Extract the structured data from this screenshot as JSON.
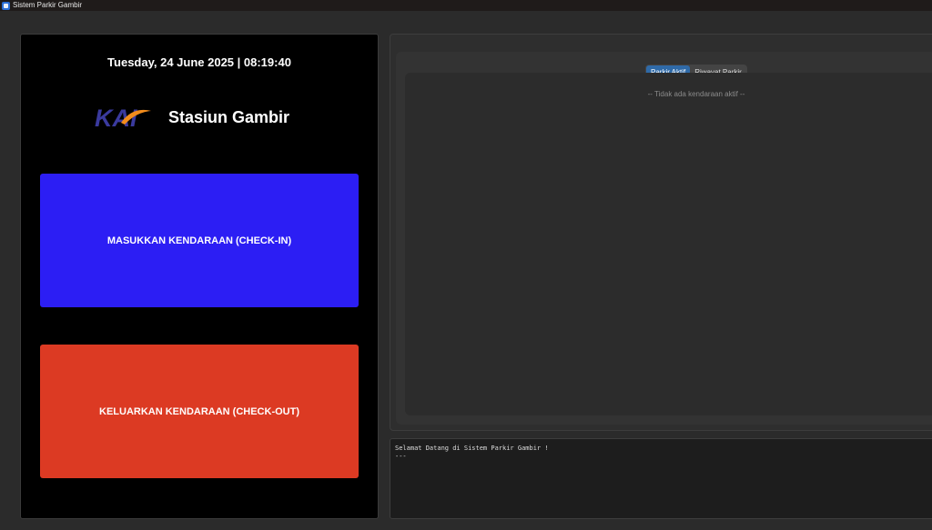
{
  "window": {
    "title": "Sistem Parkir Gambir",
    "icon": "app-window-icon"
  },
  "left_panel": {
    "datetime": "Tuesday, 24 June 2025 | 08:19:40",
    "logo_text": "KAI",
    "station_name": "Stasiun Gambir",
    "checkin_button": "MASUKKAN KENDARAAN (CHECK-IN)",
    "checkout_button": "KELUARKAN KENDARAAN (CHECK-OUT)"
  },
  "right_panel": {
    "tabs": [
      {
        "label": "Parkir Aktif",
        "active": true
      },
      {
        "label": "Riwayat Parkir",
        "active": false
      }
    ],
    "empty_message": "-- Tidak ada kendaraan aktif --"
  },
  "log": {
    "lines": "Selamat Datang di Sistem Parkir Gambir !\n---"
  },
  "colors": {
    "checkin": "#2c1ef4",
    "checkout": "#dc3a23",
    "active_tab": "#2f6aa8",
    "kai_blue": "#3a3a9e",
    "kai_orange": "#f28c1c"
  }
}
